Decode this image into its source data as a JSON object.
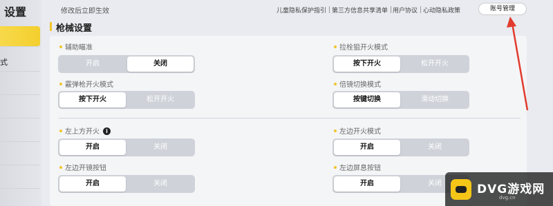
{
  "sidebar": {
    "title": "设置",
    "items": [
      {
        "label": "",
        "active": true
      },
      {
        "label": "式",
        "active": false
      },
      {
        "label": "",
        "active": false
      },
      {
        "label": "",
        "active": false
      },
      {
        "label": "",
        "active": false
      },
      {
        "label": "",
        "active": false
      },
      {
        "label": "",
        "active": false
      }
    ]
  },
  "header": {
    "hint": "修改后立即生效",
    "links": [
      "儿童隐私保护指引",
      "第三方信息共享清单",
      "用户协议",
      "心动隐私政策"
    ],
    "account_button": "账号管理"
  },
  "section": {
    "title": "枪械设置"
  },
  "settings": [
    {
      "label": "辅助瞄准",
      "options": [
        "开启",
        "关闭"
      ],
      "selected": 1
    },
    {
      "label": "拉栓狙开火模式",
      "options": [
        "按下开火",
        "松开开火"
      ],
      "selected": 0
    },
    {
      "label": "霰弹枪开火模式",
      "options": [
        "按下开火",
        "松开开火"
      ],
      "selected": 0
    },
    {
      "label": "倍镜切换模式",
      "options": [
        "按键切换",
        "滑动切换"
      ],
      "selected": 0
    },
    {
      "label": "左上方开火",
      "options": [
        "开启",
        "关闭"
      ],
      "selected": 0
    },
    {
      "label": "左边开火模式",
      "options": [
        "开启",
        "关闭"
      ],
      "selected": 0
    },
    {
      "label": "左边开镜按钮",
      "options": [
        "开启",
        "关闭"
      ],
      "selected": 0
    },
    {
      "label": "左边屏息按钮",
      "options": [
        "开启",
        "关闭"
      ],
      "selected": 0
    }
  ],
  "info_icon": {
    "glyph": "i",
    "icon": "info-icon"
  },
  "watermark": {
    "brand": "DVG游戏网",
    "domain": "dvg.cn"
  },
  "colors": {
    "accent": "#f0c52a",
    "arrow": "#e23b2e",
    "sidebar_active": "#f3cf2e"
  }
}
